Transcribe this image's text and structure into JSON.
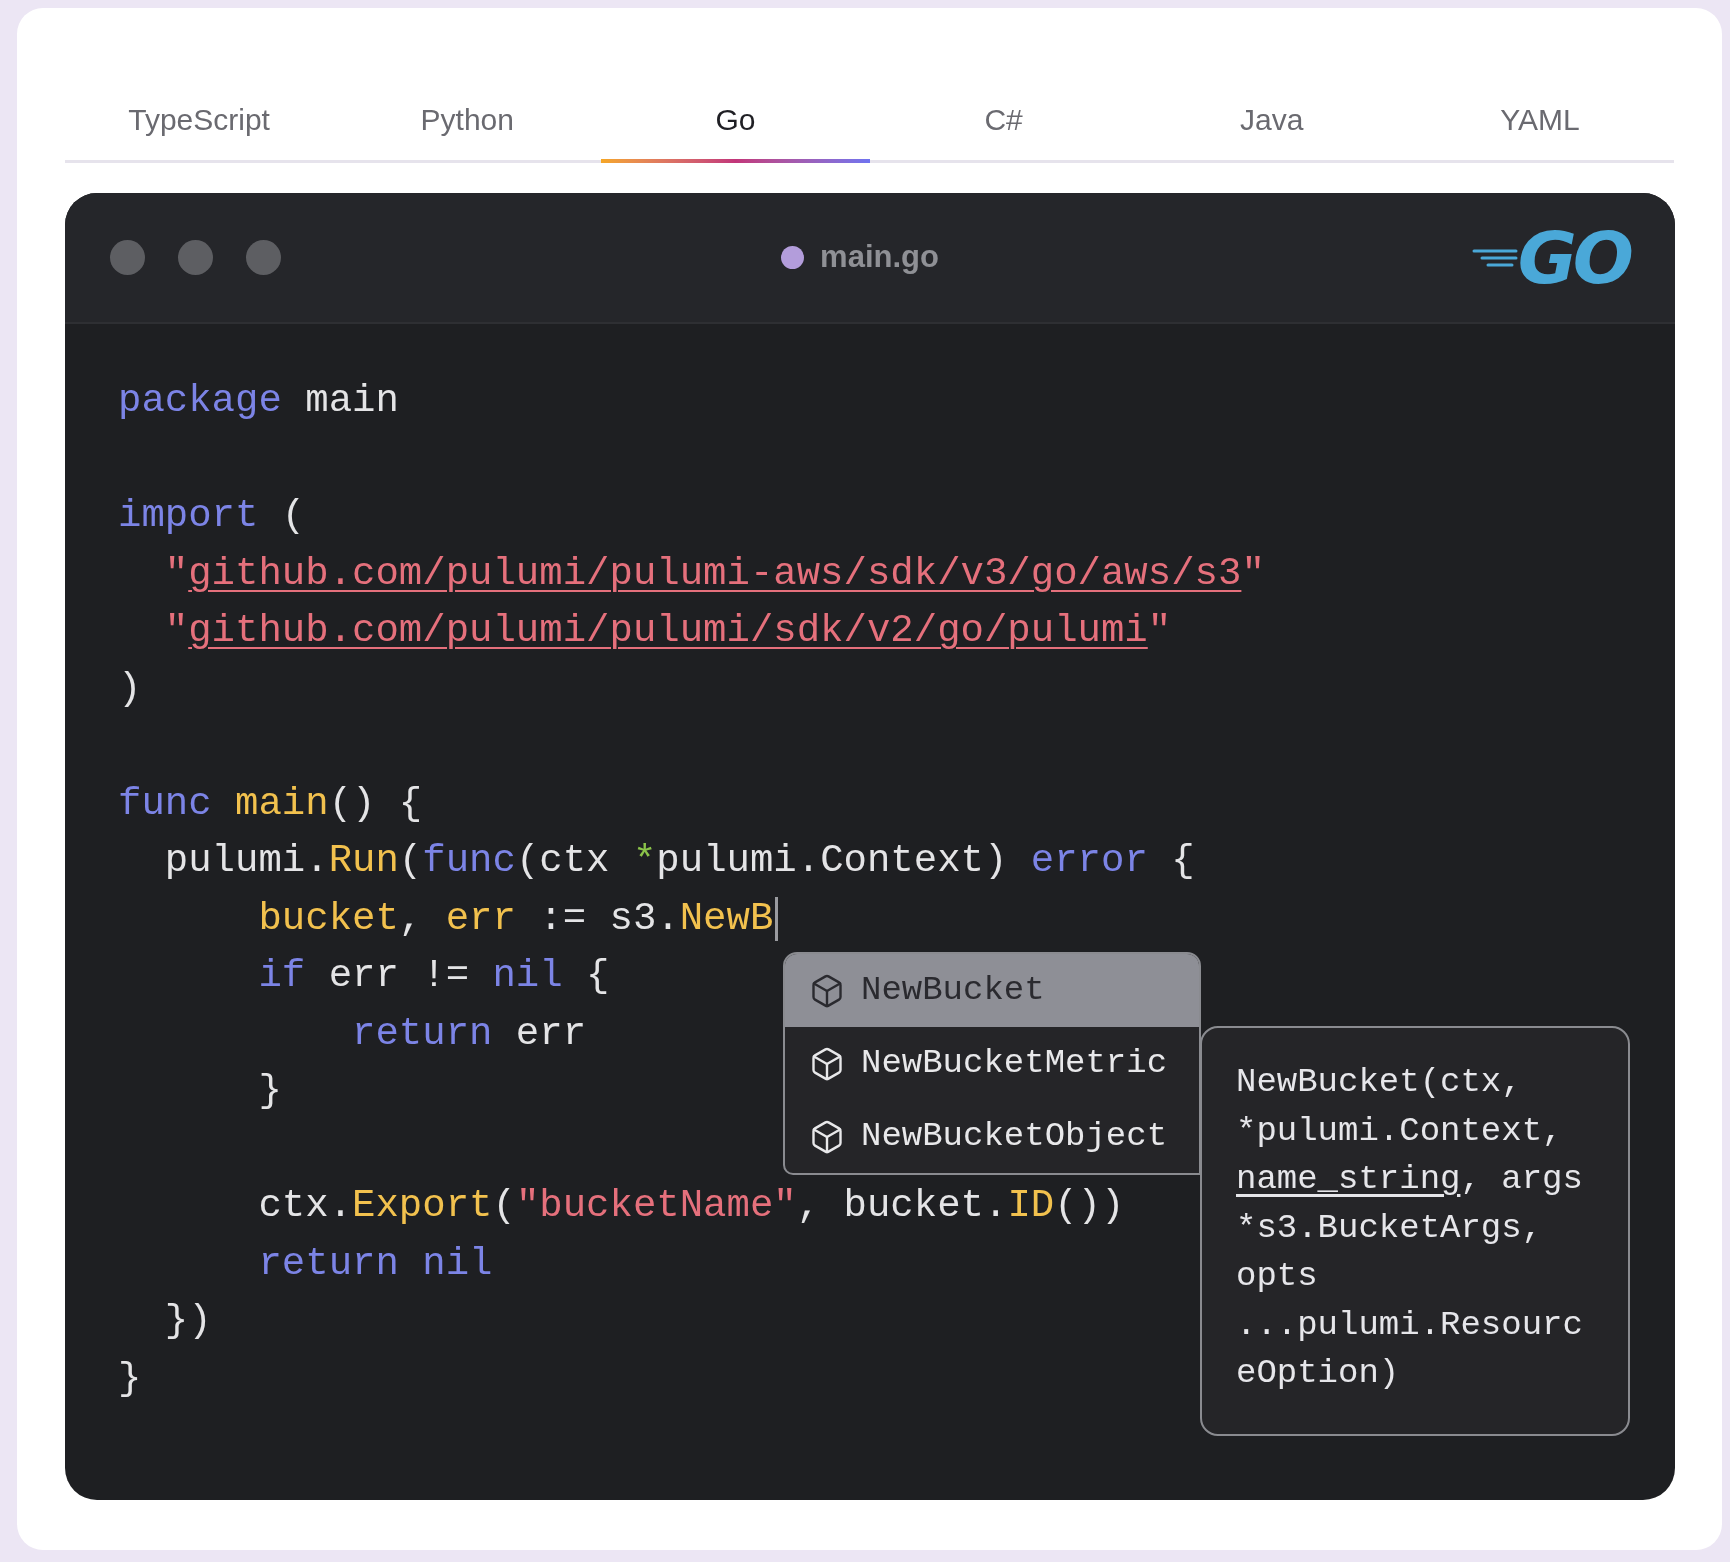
{
  "tabs": [
    {
      "label": "TypeScript",
      "selected": false
    },
    {
      "label": "Python",
      "selected": false
    },
    {
      "label": "Go",
      "selected": true
    },
    {
      "label": "C#",
      "selected": false
    },
    {
      "label": "Java",
      "selected": false
    },
    {
      "label": "YAML",
      "selected": false
    }
  ],
  "editor": {
    "file_name": "main.go",
    "logo_text": "GO",
    "code_blocks": [
      [
        {
          "tokens": [
            {
              "kind": "keyword",
              "text": "package"
            },
            {
              "kind": "plain",
              "text": " main"
            }
          ]
        }
      ],
      [
        {
          "tokens": [
            {
              "kind": "keyword",
              "text": "import"
            },
            {
              "kind": "plain",
              "text": " ("
            }
          ]
        },
        {
          "tokens": [
            {
              "kind": "string",
              "text": "  \""
            },
            {
              "kind": "link",
              "text": "github.com/pulumi/pulumi-aws/sdk/v3/go/aws/s3"
            },
            {
              "kind": "string",
              "text": "\""
            }
          ]
        },
        {
          "tokens": [
            {
              "kind": "string",
              "text": "  \""
            },
            {
              "kind": "link",
              "text": "github.com/pulumi/pulumi/sdk/v2/go/pulumi"
            },
            {
              "kind": "string",
              "text": "\""
            }
          ]
        },
        {
          "tokens": [
            {
              "kind": "plain",
              "text": ")"
            }
          ]
        }
      ],
      [
        {
          "tokens": [
            {
              "kind": "keyword",
              "text": "func "
            },
            {
              "kind": "function",
              "text": "main"
            },
            {
              "kind": "plain",
              "text": "() {"
            }
          ]
        },
        {
          "tokens": [
            {
              "kind": "plain",
              "text": "  pulumi."
            },
            {
              "kind": "function",
              "text": "Run"
            },
            {
              "kind": "plain",
              "text": "("
            },
            {
              "kind": "keyword",
              "text": "func"
            },
            {
              "kind": "plain",
              "text": "(ctx "
            },
            {
              "kind": "operator",
              "text": "*"
            },
            {
              "kind": "plain",
              "text": "pulumi.Context) "
            },
            {
              "kind": "keyword",
              "text": "error"
            },
            {
              "kind": "plain",
              "text": " {"
            }
          ]
        },
        {
          "cursor": true,
          "tokens": [
            {
              "kind": "function",
              "text": "      bucket"
            },
            {
              "kind": "plain",
              "text": ", "
            },
            {
              "kind": "function",
              "text": "err"
            },
            {
              "kind": "plain",
              "text": " := s3."
            },
            {
              "kind": "function",
              "text": "NewB"
            }
          ]
        },
        {
          "tokens": [
            {
              "kind": "keyword",
              "text": "      if"
            },
            {
              "kind": "plain",
              "text": " err != "
            },
            {
              "kind": "keyword",
              "text": "nil"
            },
            {
              "kind": "plain",
              "text": " {"
            }
          ]
        },
        {
          "tokens": [
            {
              "kind": "keyword",
              "text": "          return"
            },
            {
              "kind": "plain",
              "text": " err"
            }
          ]
        },
        {
          "tokens": [
            {
              "kind": "plain",
              "text": "      }"
            }
          ]
        }
      ],
      [
        {
          "tokens": [
            {
              "kind": "plain",
              "text": "      ctx."
            },
            {
              "kind": "function",
              "text": "Export"
            },
            {
              "kind": "plain",
              "text": "("
            },
            {
              "kind": "string",
              "text": "\"bucketName\""
            },
            {
              "kind": "plain",
              "text": ", bucket."
            },
            {
              "kind": "function",
              "text": "ID"
            },
            {
              "kind": "plain",
              "text": "())"
            }
          ]
        },
        {
          "tokens": [
            {
              "kind": "keyword",
              "text": "      return nil"
            }
          ]
        },
        {
          "tokens": [
            {
              "kind": "plain",
              "text": "  })"
            }
          ]
        },
        {
          "tokens": [
            {
              "kind": "plain",
              "text": "}"
            }
          ]
        }
      ]
    ],
    "suggestions": [
      {
        "label": "NewBucket",
        "selected": true
      },
      {
        "label": "NewBucketMetric",
        "selected": false
      },
      {
        "label": "NewBucketObject",
        "selected": false
      }
    ],
    "signature": [
      {
        "text": "NewBucket(ctx, *pulumi.Context, ",
        "underline": false
      },
      {
        "text": "name_string",
        "underline": true
      },
      {
        "text": ", args *s3.BucketArgs, opts ...pulumi.ResourceOption)",
        "underline": false
      }
    ]
  }
}
